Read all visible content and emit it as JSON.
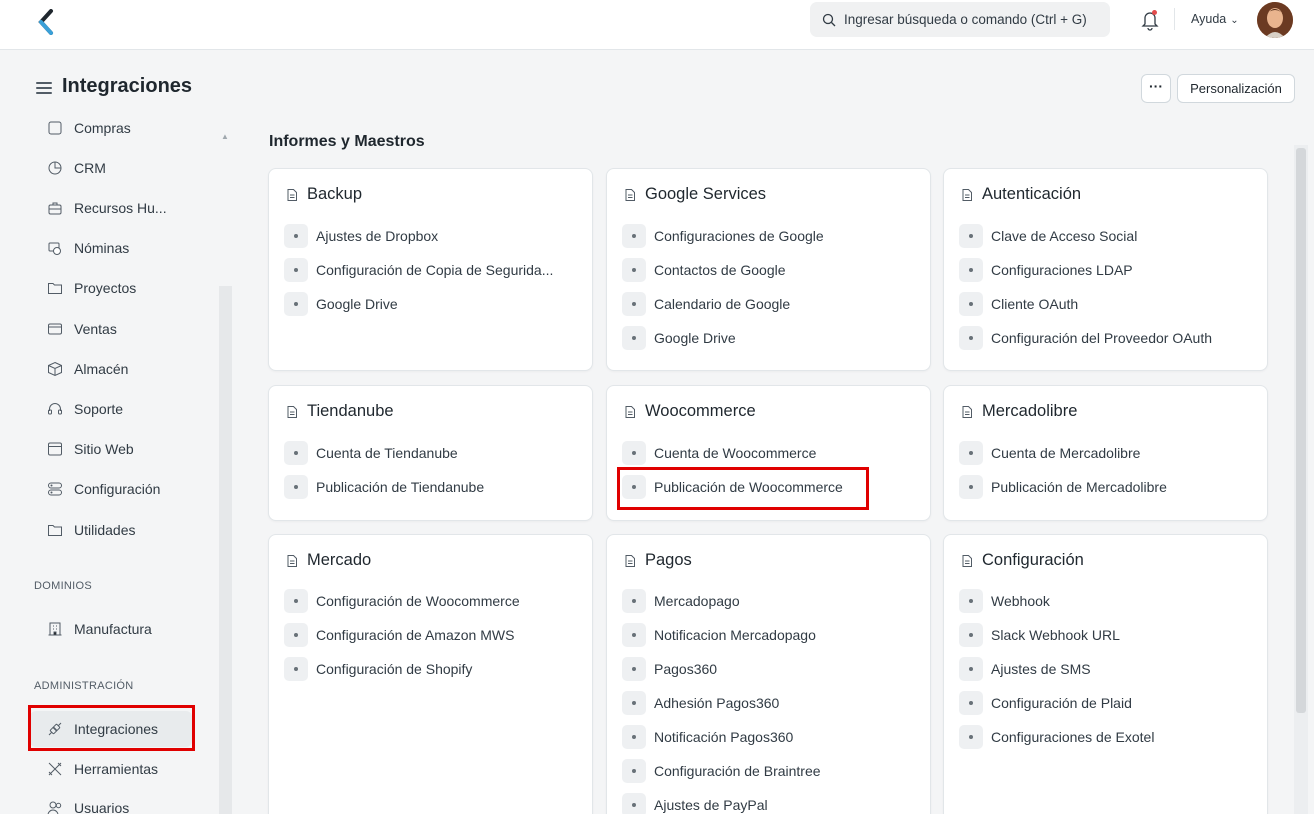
{
  "navbar": {
    "search_placeholder": "Ingresar búsqueda o comando (Ctrl + G)",
    "help_label": "Ayuda"
  },
  "page": {
    "title": "Integraciones",
    "more_label": "···",
    "customize_label": "Personalización"
  },
  "sidebar": {
    "partial_top_label": "Compras",
    "items": [
      {
        "label": "CRM",
        "icon": "crm-icon"
      },
      {
        "label": "Recursos Hu...",
        "icon": "hr-icon"
      },
      {
        "label": "Nóminas",
        "icon": "payroll-icon"
      },
      {
        "label": "Proyectos",
        "icon": "folder-icon"
      },
      {
        "label": "Ventas",
        "icon": "sales-icon"
      },
      {
        "label": "Almacén",
        "icon": "box-icon"
      },
      {
        "label": "Soporte",
        "icon": "headset-icon"
      },
      {
        "label": "Sitio Web",
        "icon": "browser-icon"
      },
      {
        "label": "Configuración",
        "icon": "settings-icon"
      },
      {
        "label": "Utilidades",
        "icon": "folder-icon"
      }
    ],
    "domains_section": "DOMINIOS",
    "domains": [
      {
        "label": "Manufactura",
        "icon": "factory-icon"
      }
    ],
    "admin_section": "ADMINISTRACIÓN",
    "admin": [
      {
        "label": "Integraciones",
        "icon": "integration-icon",
        "active": true
      },
      {
        "label": "Herramientas",
        "icon": "tools-icon"
      },
      {
        "label": "Usuarios",
        "icon": "users-icon"
      }
    ]
  },
  "main": {
    "section_title": "Informes y Maestros",
    "cards": [
      {
        "title": "Backup",
        "links": [
          "Ajustes de Dropbox",
          "Configuración de Copia de Segurida...",
          "Google Drive"
        ]
      },
      {
        "title": "Google Services",
        "links": [
          "Configuraciones de Google",
          "Contactos de Google",
          "Calendario de Google",
          "Google Drive"
        ]
      },
      {
        "title": "Autenticación",
        "links": [
          "Clave de Acceso Social",
          "Configuraciones LDAP",
          "Cliente OAuth",
          "Configuración del Proveedor OAuth"
        ]
      },
      {
        "title": "Tiendanube",
        "links": [
          "Cuenta de Tiendanube",
          "Publicación de Tiendanube"
        ]
      },
      {
        "title": "Woocommerce",
        "links": [
          "Cuenta de Woocommerce",
          "Publicación de Woocommerce"
        ]
      },
      {
        "title": "Mercadolibre",
        "links": [
          "Cuenta de Mercadolibre",
          "Publicación de Mercadolibre"
        ]
      },
      {
        "title": "Mercado",
        "links": [
          "Configuración de Woocommerce",
          "Configuración de Amazon MWS",
          "Configuración de Shopify"
        ]
      },
      {
        "title": "Pagos",
        "links": [
          "Mercadopago",
          "Notificacion Mercadopago",
          "Pagos360",
          "Adhesión Pagos360",
          "Notificación Pagos360",
          "Configuración de Braintree",
          "Ajustes de PayPal"
        ]
      },
      {
        "title": "Configuración",
        "links": [
          "Webhook",
          "Slack Webhook URL",
          "Ajustes de SMS",
          "Configuración de Plaid",
          "Configuraciones de Exotel"
        ]
      }
    ]
  }
}
